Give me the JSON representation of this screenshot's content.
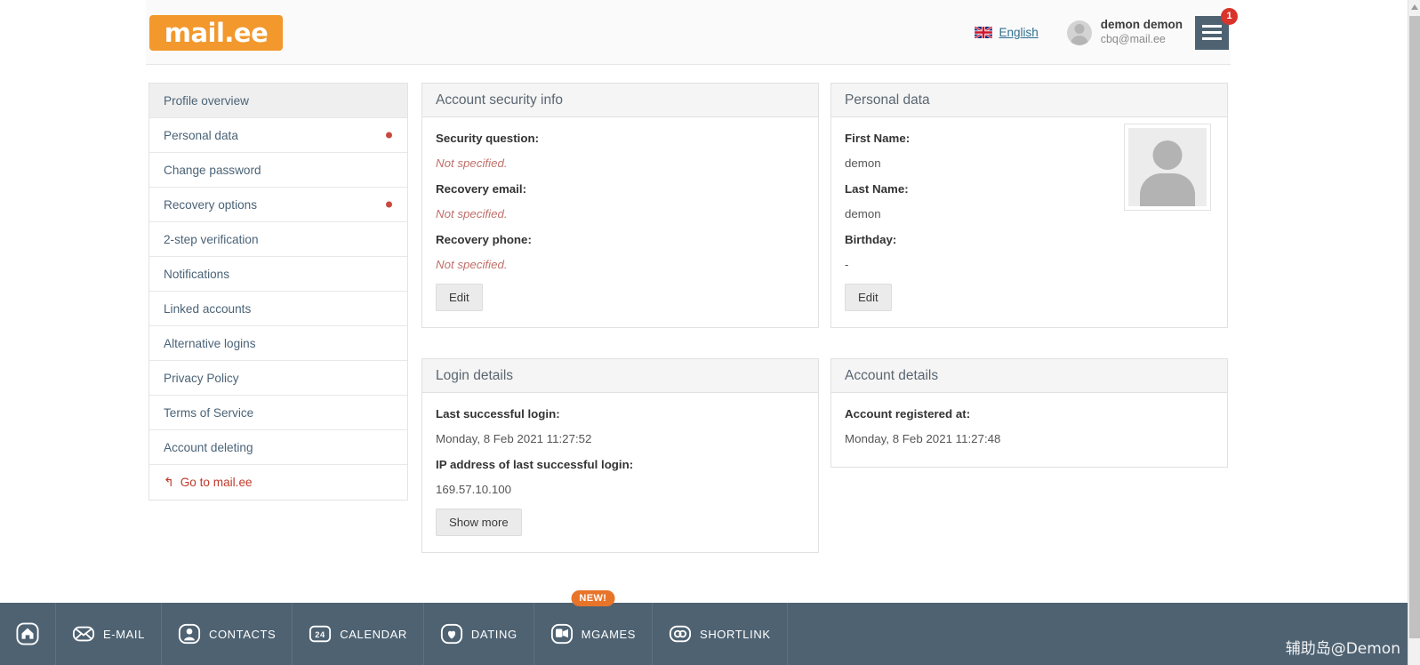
{
  "header": {
    "logo_text": "mail.ee",
    "language": {
      "label": "English",
      "icon": "uk-flag-icon"
    },
    "user": {
      "name": "demon demon",
      "email": "cbq@mail.ee"
    },
    "menu": {
      "icon": "hamburger-menu-icon",
      "badge": "1"
    }
  },
  "sidebar": {
    "items": [
      {
        "label": "Profile overview",
        "active": true,
        "dot": false,
        "external": false
      },
      {
        "label": "Personal data",
        "active": false,
        "dot": true,
        "external": false
      },
      {
        "label": "Change password",
        "active": false,
        "dot": false,
        "external": false
      },
      {
        "label": "Recovery options",
        "active": false,
        "dot": true,
        "external": false
      },
      {
        "label": "2-step verification",
        "active": false,
        "dot": false,
        "external": false
      },
      {
        "label": "Notifications",
        "active": false,
        "dot": false,
        "external": false
      },
      {
        "label": "Linked accounts",
        "active": false,
        "dot": false,
        "external": false
      },
      {
        "label": "Alternative logins",
        "active": false,
        "dot": false,
        "external": false
      },
      {
        "label": "Privacy Policy",
        "active": false,
        "dot": false,
        "external": false
      },
      {
        "label": "Terms of Service",
        "active": false,
        "dot": false,
        "external": false
      },
      {
        "label": "Account deleting",
        "active": false,
        "dot": false,
        "external": false
      },
      {
        "label": "Go to mail.ee",
        "active": false,
        "dot": false,
        "external": true
      }
    ]
  },
  "panels": {
    "security": {
      "title": "Account security info",
      "fields": [
        {
          "label": "Security question:",
          "value": "Not specified.",
          "unset": true
        },
        {
          "label": "Recovery email:",
          "value": "Not specified.",
          "unset": true
        },
        {
          "label": "Recovery phone:",
          "value": "Not specified.",
          "unset": true
        }
      ],
      "button": "Edit"
    },
    "personal": {
      "title": "Personal data",
      "fields": [
        {
          "label": "First Name:",
          "value": "demon",
          "unset": false
        },
        {
          "label": "Last Name:",
          "value": "demon",
          "unset": false
        },
        {
          "label": "Birthday:",
          "value": "-",
          "unset": false
        }
      ],
      "button": "Edit",
      "avatar": "user-avatar-placeholder"
    },
    "login": {
      "title": "Login details",
      "fields": [
        {
          "label": "Last successful login:",
          "value": "Monday, 8 Feb 2021 11:27:52",
          "unset": false
        },
        {
          "label": "IP address of last successful login:",
          "value": "169.57.10.100",
          "unset": false
        }
      ],
      "button": "Show more"
    },
    "account": {
      "title": "Account details",
      "fields": [
        {
          "label": "Account registered at:",
          "value": "Monday, 8 Feb 2021 11:27:48",
          "unset": false
        }
      ]
    }
  },
  "bottom_nav": {
    "items": [
      {
        "label": "",
        "icon": "home-icon",
        "badge": ""
      },
      {
        "label": "E-MAIL",
        "icon": "envelope-icon",
        "badge": ""
      },
      {
        "label": "CONTACTS",
        "icon": "contacts-icon",
        "badge": ""
      },
      {
        "label": "CALENDAR",
        "icon": "calendar-icon",
        "badge": ""
      },
      {
        "label": "DATING",
        "icon": "dating-icon",
        "badge": ""
      },
      {
        "label": "MGAMES",
        "icon": "games-icon",
        "badge": "NEW!"
      },
      {
        "label": "SHORTLINK",
        "icon": "shortlink-icon",
        "badge": ""
      }
    ]
  },
  "watermark": "辅助岛@Demon",
  "colors": {
    "brand_orange": "#f2982c",
    "bottom_bar": "#4e6272",
    "badge_red": "#d9342b",
    "link_blue": "#31708f",
    "alert_red": "#c9493f"
  }
}
